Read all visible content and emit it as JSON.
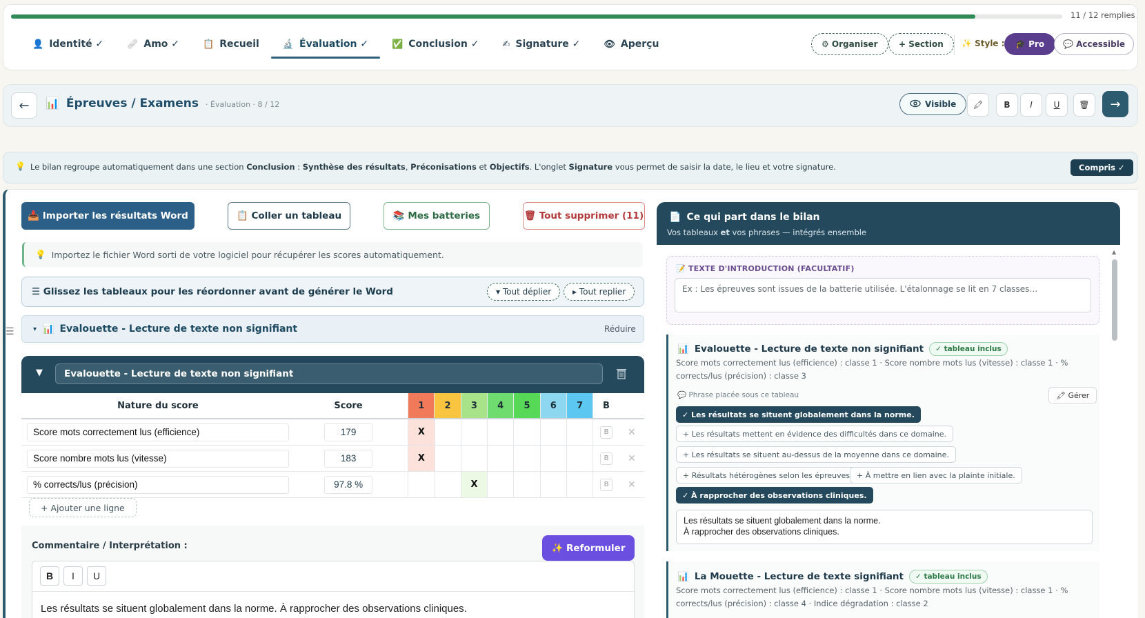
{
  "progress": {
    "label": "11 / 12 remplies",
    "fraction": 0.917
  },
  "tabs": [
    {
      "icon": "👤",
      "label": "Identité ✓"
    },
    {
      "icon": "🩹",
      "label": "Amo ✓"
    },
    {
      "icon": "📋",
      "label": "Recueil"
    },
    {
      "icon": "🔬",
      "label": "Évaluation ✓"
    },
    {
      "icon": "✅",
      "label": "Conclusion ✓"
    },
    {
      "icon": "✍",
      "label": "Signature ✓"
    },
    {
      "icon": "👁",
      "label": "Aperçu"
    }
  ],
  "toolbar": {
    "organize": "⚙ Organiser",
    "section": "+ Section",
    "style_label": "✨ Style :",
    "pro": "🎓 Pro",
    "accessible": "💬 Accessible"
  },
  "section": {
    "back": "←",
    "icon": "📊",
    "title": "Épreuves / Examens",
    "subtitle": "· Évaluation · 8 / 12",
    "visible": "Visible",
    "fmt": [
      "🖍",
      "B",
      "I",
      "U",
      "🗑"
    ],
    "next": "→"
  },
  "banner": {
    "icon": "💡",
    "t1": "Le bilan regroupe automatiquement dans une section ",
    "b1": "Conclusion",
    "t2": " : ",
    "b2": "Synthèse des résultats",
    "t3": ", ",
    "b3": "Préconisations",
    "t4": " et ",
    "b4": "Objectifs",
    "t5": ". L'onglet ",
    "b5": "Signature",
    "t6": " vous permet de saisir la date, le lieu et votre signature.",
    "button": "Compris ✓"
  },
  "actions": {
    "import": "📥 Importer les résultats Word",
    "paste": "📋 Coller un tableau",
    "batteries": "📚 Mes batteries",
    "delete_all": "🗑 Tout supprimer (11)"
  },
  "tip": {
    "icon": "💡",
    "text": "Importez le fichier Word sorti de votre logiciel pour récupérer les scores automatiquement."
  },
  "reorder": {
    "text": "☰ Glissez les tableaux pour les réordonner avant de générer le Word",
    "expand": "▾ Tout déplier",
    "collapse": "▸ Tout replier"
  },
  "collapsed": {
    "handle": "☰",
    "arrow": "▾",
    "icon": "📊",
    "title": "Evalouette - Lecture de texte non signifiant",
    "reduce": "Réduire"
  },
  "table": {
    "toggle": "▼",
    "name": "Evalouette - Lecture de texte non signifiant",
    "headers": {
      "nature": "Nature du score",
      "score": "Score",
      "classes": [
        "1",
        "2",
        "3",
        "4",
        "5",
        "6",
        "7"
      ],
      "b": "B"
    },
    "class_colors": [
      "#f07a5a",
      "#f9c440",
      "#a8e38a",
      "#6fdc6f",
      "#57d957",
      "#8ed7f0",
      "#5cc8f2"
    ],
    "rows": [
      {
        "nature": "Score mots correctement lus (efficience)",
        "score": "179",
        "class": 1,
        "mark": "X",
        "b": "B",
        "del": "✕"
      },
      {
        "nature": "Score nombre mots lus (vitesse)",
        "score": "183",
        "class": 1,
        "mark": "X",
        "b": "B",
        "del": "✕"
      },
      {
        "nature": "% corrects/lus (précision)",
        "score": "97.8 %",
        "class": 3,
        "mark": "X",
        "b": "B",
        "del": "✕"
      }
    ],
    "add_line": "+ Ajouter une ligne"
  },
  "comment": {
    "label": "Commentaire / Interprétation :",
    "reformulate": "✨ Reformuler",
    "tools": [
      "B",
      "I",
      "U"
    ],
    "text": "Les résultats se situent globalement dans la norme. À rapprocher des observations cliniques."
  },
  "right": {
    "icon": "📄",
    "title": "Ce qui part dans le bilan",
    "subtitle_a": "Vos tableaux ",
    "subtitle_b": "et",
    "subtitle_c": " vos phrases — intégrés ensemble",
    "intro_label": "📝 TEXTE D'INTRODUCTION (FACULTATIF)",
    "intro_placeholder": "Ex : Les épreuves sont issues de la batterie utilisée. L'étalonnage se lit en 7 classes…",
    "card1": {
      "icon": "📊",
      "title": "Evalouette - Lecture de texte non signifiant",
      "badge": "✓ tableau inclus",
      "desc": "Score mots correctement lus (efficience) : classe 1 · Score nombre mots lus (vitesse) : classe 1 · % corrects/lus (précision) : classe 3",
      "phrase_label": "💬 Phrase placée sous ce tableau",
      "manage": "🖍 Gérer",
      "chips": [
        {
          "text": "✓ Les résultats se situent globalement dans la norme.",
          "on": true
        },
        {
          "text": "+ Les résultats mettent en évidence des difficultés dans ce domaine.",
          "on": false
        },
        {
          "text": "+ Les résultats se situent au-dessus de la moyenne dans ce domaine.",
          "on": false
        },
        {
          "text": "+ Résultats hétérogènes selon les épreuves.",
          "on": false
        },
        {
          "text": "+ À mettre en lien avec la plainte initiale.",
          "on": false
        },
        {
          "text": "✓ À rapprocher des observations cliniques.",
          "on": true
        }
      ],
      "textarea_line1": "Les résultats se situent globalement dans la norme.",
      "textarea_line2": "À rapprocher des observations cliniques."
    },
    "card2": {
      "icon": "📊",
      "title": "La Mouette - Lecture de texte signifiant",
      "badge": "✓ tableau inclus",
      "desc": "Score mots correctement lus (efficience) : classe 1 · Score nombre mots lus (vitesse) : classe 1 · % corrects/lus (précision) : classe 4 · Indice dégradation : classe 2"
    }
  }
}
